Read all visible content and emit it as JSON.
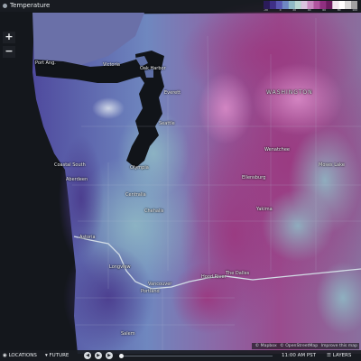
{
  "app": {
    "title": "Temperature"
  },
  "colors": {
    "land_cold": "#5a3f9a",
    "land_cool": "#6f7fc0",
    "land_mild": "#8fb6c6",
    "land_warm": "#a13f86",
    "land_hot": "#c26ab4",
    "water": "#12151a",
    "bars": "#1f2329"
  },
  "legend": {
    "labels": [
      "-20",
      "0",
      "20",
      "40",
      "60",
      "80",
      "100"
    ]
  },
  "zoom": {
    "in_label": "+",
    "out_label": "−"
  },
  "places": {
    "port_angeles": "Port Ang.",
    "victoria": "Victoria",
    "oak_harbor": "Oak Harbor",
    "everett": "Everett",
    "seattle": "Seattle",
    "olympia": "Olympia",
    "centralia": "Centralia",
    "chehalis": "Chehalis",
    "coastal_south": "Coastal South",
    "aberdeen": "Aberdeen",
    "astoria": "Astoria",
    "longview": "Longview",
    "portland": "Portland",
    "vancouver": "Vancouver",
    "wenatchee": "Wenatchee",
    "yakima": "Yakima",
    "ellensburg": "Ellensburg",
    "moses_lake": "Moses Lake",
    "the_dalles": "The Dalles",
    "hood_river": "Hood River",
    "salem": "Salem",
    "state_label": "WASHINGTON"
  },
  "attribution": {
    "mapbox": "© Mapbox",
    "osm": "© OpenStreetMap",
    "improve": "Improve this map"
  },
  "bottom": {
    "locations_label": "LOCATIONS",
    "future_label": "FUTURE",
    "time": "11:00 AM PST",
    "layers_label": "LAYERS"
  }
}
